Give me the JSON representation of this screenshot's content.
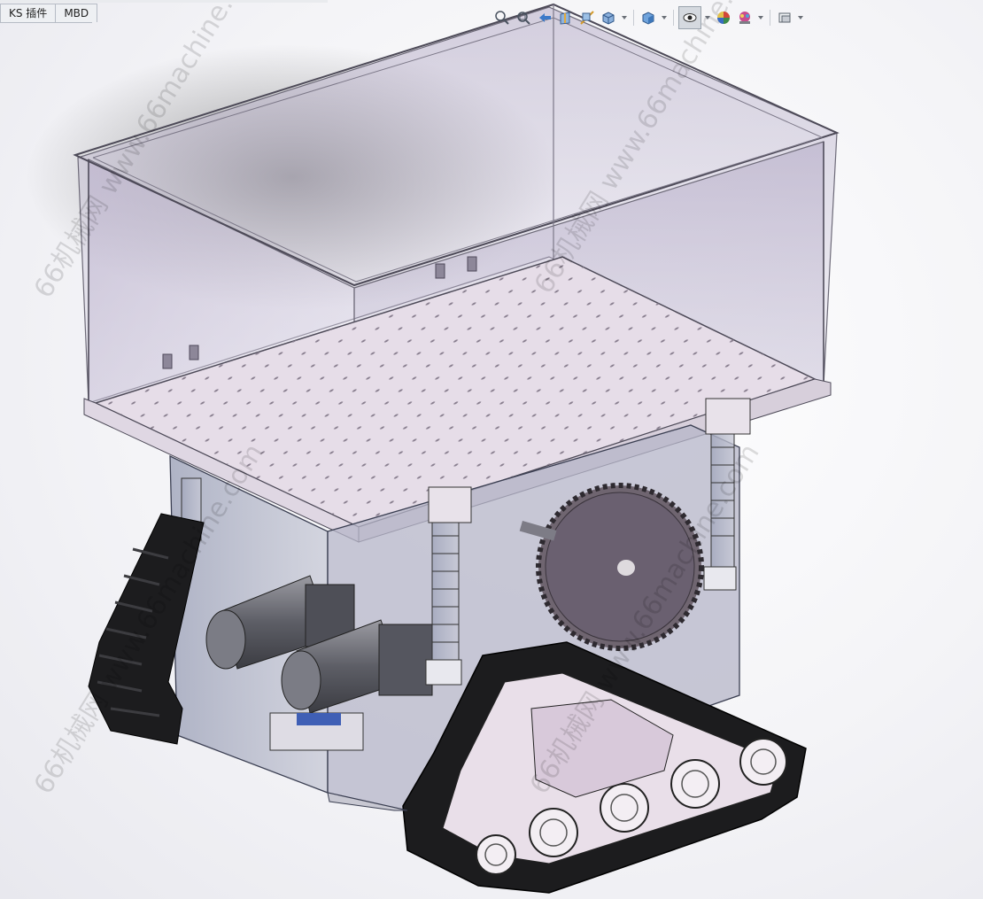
{
  "tabs": [
    {
      "label": "KS 插件"
    },
    {
      "label": "MBD"
    }
  ],
  "view_toolbar": {
    "icons": [
      "zoom-to-fit-icon",
      "zoom-to-area-icon",
      "previous-view-icon",
      "section-view-icon",
      "dynamic-annotation-icon",
      "view-orientation-icon",
      "display-style-icon",
      "hide-show-items-icon",
      "edit-appearance-icon",
      "apply-scene-icon",
      "view-settings-icon"
    ]
  },
  "watermarks": [
    "66机械网 www.66machine.com",
    "66机械网 www.66machine.com",
    "66机械网 www.66machine.com",
    "66机械网 www.66machine.com"
  ],
  "colors": {
    "viewport_bg": "#f4f4f7",
    "enclosure_glass": "#c9c2d8",
    "track": "#1c1c1e",
    "gear": "#6f6570",
    "plate": "#e6dde8"
  }
}
